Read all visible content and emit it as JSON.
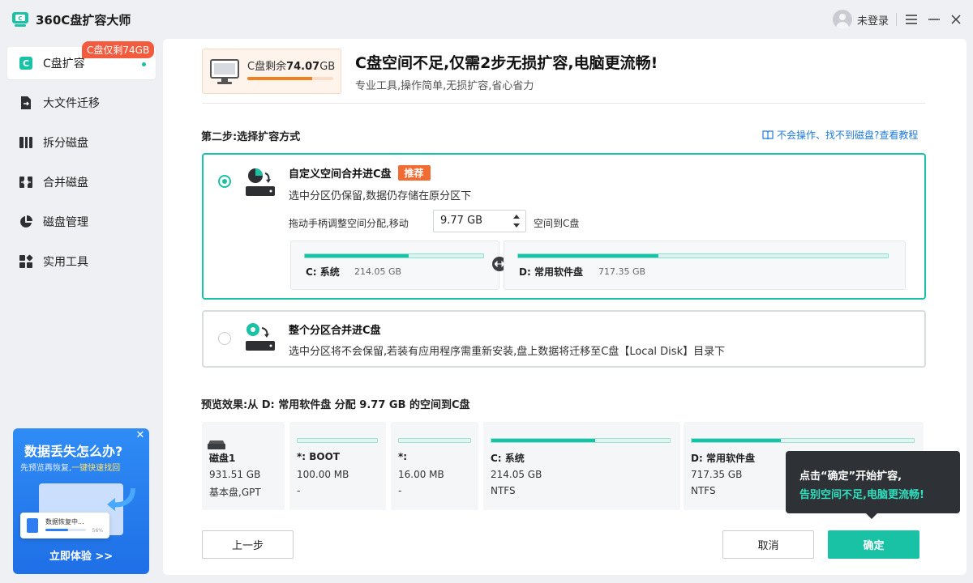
{
  "app": {
    "title": "360C盘扩容大师",
    "user_label": "未登录"
  },
  "sidebar": {
    "badge": "C盘仅剩74GB",
    "items": [
      {
        "label": "C盘扩容",
        "icon": "c-drive-icon"
      },
      {
        "label": "大文件迁移",
        "icon": "file-move-icon"
      },
      {
        "label": "拆分磁盘",
        "icon": "split-disk-icon"
      },
      {
        "label": "合并磁盘",
        "icon": "merge-disk-icon"
      },
      {
        "label": "磁盘管理",
        "icon": "pie-chart-icon"
      },
      {
        "label": "实用工具",
        "icon": "grid-tools-icon"
      }
    ]
  },
  "promo": {
    "title": "数据丢失怎么办?",
    "subtitle_plain": "先预览再恢复,",
    "subtitle_highlight": "一键快速找回",
    "card_text": "数据恢复中...",
    "card_progress_label": "56%",
    "progress": 0.56,
    "cta": "立即体验 >>"
  },
  "header": {
    "c_free_prefix": "C盘剩余",
    "c_free_value": "74.07",
    "c_free_unit": "GB",
    "c_used_fraction": 0.75,
    "headline": "C盘空间不足,仅需2步无损扩容,电脑更流畅!",
    "subline": "专业工具,操作简单,无损扩容,省心省力"
  },
  "step": {
    "title": "第二步:选择扩容方式",
    "help_link": "不会操作、找不到磁盘?查看教程"
  },
  "options": [
    {
      "title": "自定义空间合并进C盘",
      "tag": "推荐",
      "desc": "选中分区仍保留,数据仍存储在原分区下",
      "selected": true,
      "adjust_prefix": "拖动手柄调整空间分配,移动",
      "adjust_value": "9.77  GB",
      "adjust_suffix": "空间到C盘",
      "partitions": [
        {
          "name": "C: 系统",
          "size": "214.05   GB",
          "used_fraction": 0.58
        },
        {
          "name": "D: 常用软件盘",
          "size": "717.35   GB",
          "used_fraction": 0.38
        }
      ]
    },
    {
      "title": "整个分区合并进C盘",
      "desc": "选中分区将不会保留,若装有应用程序需重新安装,盘上数据将迁移至C盘【Local Disk】目录下",
      "selected": false
    }
  ],
  "preview": {
    "title": "预览效果:从 D: 常用软件盘 分配 9.77  GB 的空间到C盘",
    "disk": {
      "name": "磁盘1",
      "size": "931.51   GB",
      "type": "基本盘,GPT"
    },
    "partitions": [
      {
        "name": "*: BOOT",
        "size": "100.00   MB",
        "fs": "-",
        "used_fraction": 0.0
      },
      {
        "name": "*:",
        "size": "16.00   MB",
        "fs": "-",
        "used_fraction": 0.0
      },
      {
        "name": "C: 系统",
        "size": "214.05   GB",
        "fs": "NTFS",
        "used_fraction": 0.58
      },
      {
        "name": "D: 常用软件盘",
        "size": "717.35   GB",
        "fs": "NTFS",
        "used_fraction": 0.4
      }
    ]
  },
  "buttons": {
    "back": "上一步",
    "cancel": "取消",
    "confirm": "确定"
  },
  "tooltip": {
    "line1": "点击“确定”开始扩容,",
    "line2": "告别空间不足,电脑更流畅!"
  },
  "colors": {
    "accent": "#19c2a5",
    "badge": "#f35b3f",
    "tag": "#f26b32",
    "link": "#1f7ae0"
  }
}
